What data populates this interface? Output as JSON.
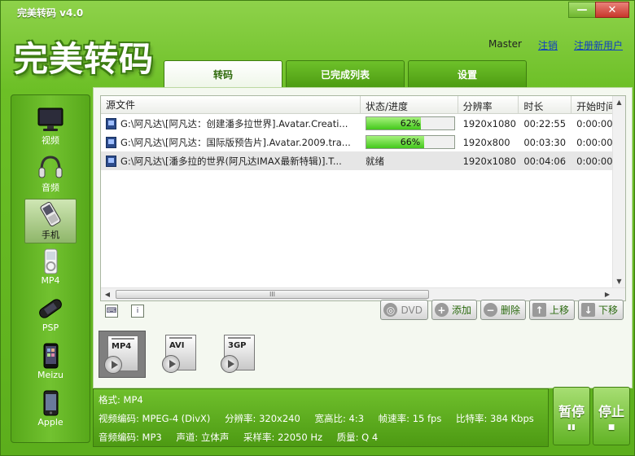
{
  "window": {
    "title": "完美转码 v4.0",
    "logo_text": "完美转码",
    "minimize_label": "—",
    "close_label": "✕"
  },
  "user": {
    "name": "Master",
    "logout_label": "注销",
    "register_label": "注册新用户"
  },
  "tabs": [
    {
      "label": "转码",
      "active": true
    },
    {
      "label": "已完成列表",
      "active": false
    },
    {
      "label": "设置",
      "active": false
    }
  ],
  "sidebar": {
    "items": [
      {
        "label": "视频",
        "icon": "monitor-icon"
      },
      {
        "label": "音频",
        "icon": "headphones-icon"
      },
      {
        "label": "手机",
        "icon": "mobile-phone-icon",
        "active": true
      },
      {
        "label": "MP4",
        "icon": "mp4-player-icon"
      },
      {
        "label": "PSP",
        "icon": "psp-icon"
      },
      {
        "label": "Meizu",
        "icon": "meizu-phone-icon"
      },
      {
        "label": "Apple",
        "icon": "iphone-icon"
      }
    ]
  },
  "table": {
    "headers": [
      "源文件",
      "状态/进度",
      "分辨率",
      "时长",
      "开始时间"
    ],
    "rows": [
      {
        "file": "G:\\阿凡达\\[阿凡达：创建潘多拉世界].Avatar.Creati...",
        "progress": 62,
        "progress_label": "62%",
        "status": "",
        "resolution": "1920x1080",
        "duration": "00:22:55",
        "start": "0:00:00"
      },
      {
        "file": "G:\\阿凡达\\[阿凡达：国际版预告片].Avatar.2009.tra...",
        "progress": 66,
        "progress_label": "66%",
        "status": "",
        "resolution": "1920x800",
        "duration": "00:03:30",
        "start": "0:00:00"
      },
      {
        "file": "G:\\阿凡达\\[潘多拉的世界(阿凡达IMAX最新特辑)].T...",
        "progress": null,
        "progress_label": "",
        "status": "就绪",
        "resolution": "1920x1080",
        "duration": "00:04:06",
        "start": "0:00:00",
        "selected": true
      }
    ],
    "scroll_grip": "III"
  },
  "actions": {
    "dvd": "DVD",
    "add": "添加",
    "delete": "删除",
    "move_up": "上移",
    "move_down": "下移"
  },
  "formats": [
    {
      "label": "MP4",
      "active": true
    },
    {
      "label": "AVI",
      "active": false
    },
    {
      "label": "3GP",
      "active": false
    }
  ],
  "info": {
    "format": "格式: MP4",
    "video_codec": "视频编码: MPEG-4 (DivX)",
    "resolution": "分辨率: 320x240",
    "aspect": "宽高比: 4:3",
    "frame_rate": "帧速率: 15 fps",
    "bitrate": "比特率: 384 Kbps",
    "audio_codec": "音频编码: MP3",
    "channels": "声道: 立体声",
    "sample_rate": "采样率: 22050 Hz",
    "quality": "质量: Q 4"
  },
  "controls": {
    "pause": "暂停",
    "stop": "停止",
    "pause_symbol": "▮▮",
    "stop_symbol": "■"
  },
  "colors": {
    "accent_green": "#6cbf26",
    "progress_green": "#43c81b",
    "link_blue": "#1040c0"
  }
}
